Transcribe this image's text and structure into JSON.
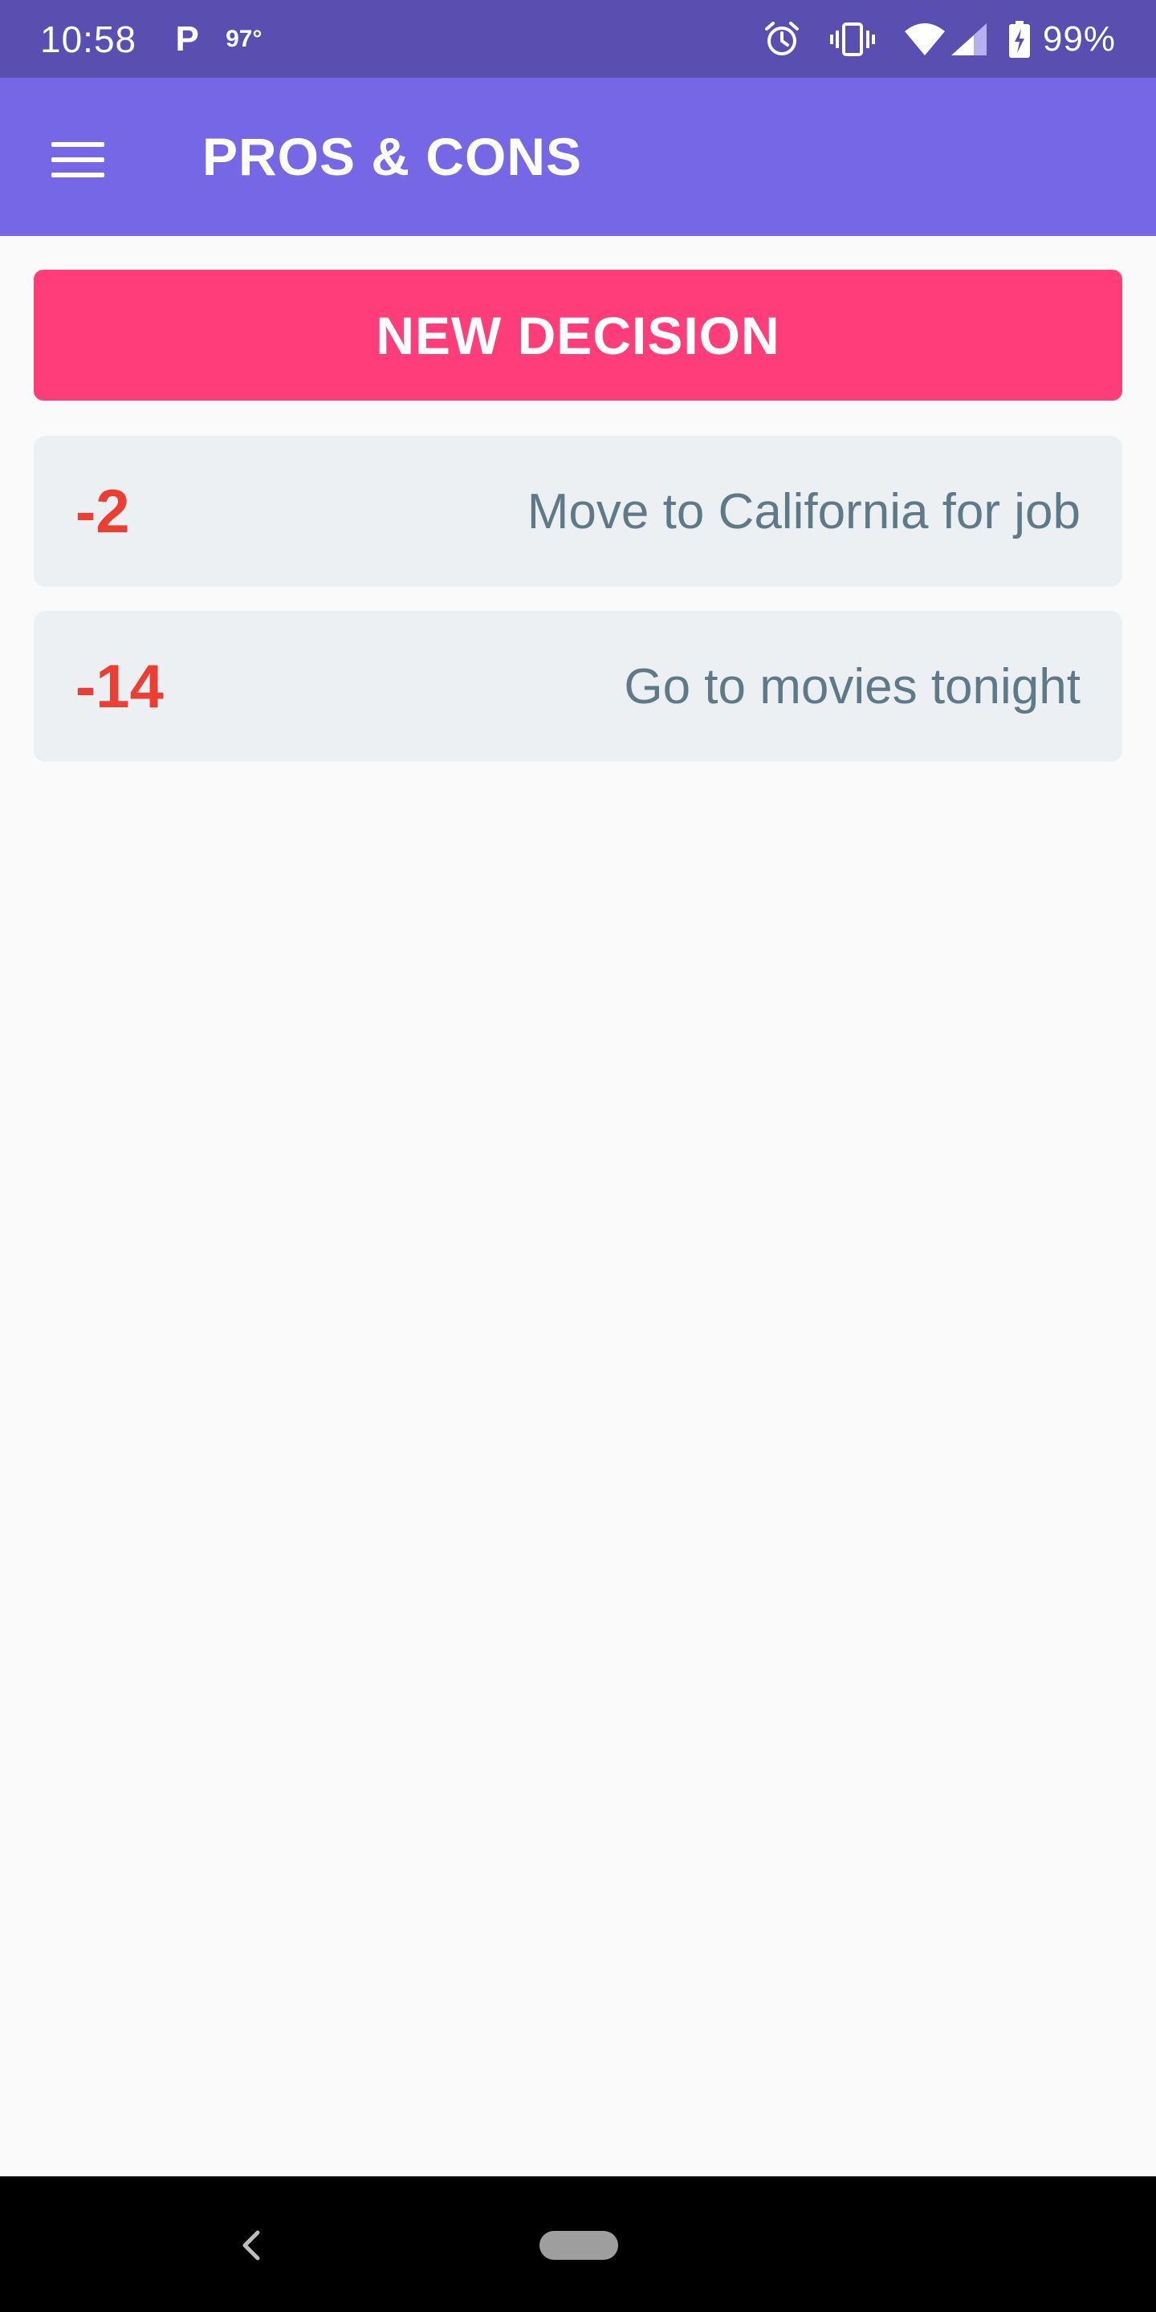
{
  "status_bar": {
    "time": "10:58",
    "p_icon": "P",
    "temperature": "97°",
    "battery": "99%",
    "icons": [
      "parking-icon",
      "alarm-icon",
      "vibrate-icon",
      "wifi-icon",
      "signal-icon",
      "battery-charging-icon"
    ]
  },
  "app_bar": {
    "title": "PROS & CONS",
    "menu_icon": "hamburger-menu-icon"
  },
  "actions": {
    "new_decision_label": "NEW DECISION"
  },
  "decisions": [
    {
      "score": "-2",
      "title": "Move to California for job"
    },
    {
      "score": "-14",
      "title": "Go to movies tonight"
    }
  ],
  "colors": {
    "status_bar": "#5a4fb0",
    "app_bar": "#7667e6",
    "primary_button": "#ff3d7a",
    "negative_score": "#ec3f34",
    "card_background": "#edf0f3",
    "card_text": "#5e7a89",
    "background": "#fafafa"
  },
  "nav_bar": {
    "icons": [
      "back-icon",
      "home-pill-icon"
    ]
  }
}
